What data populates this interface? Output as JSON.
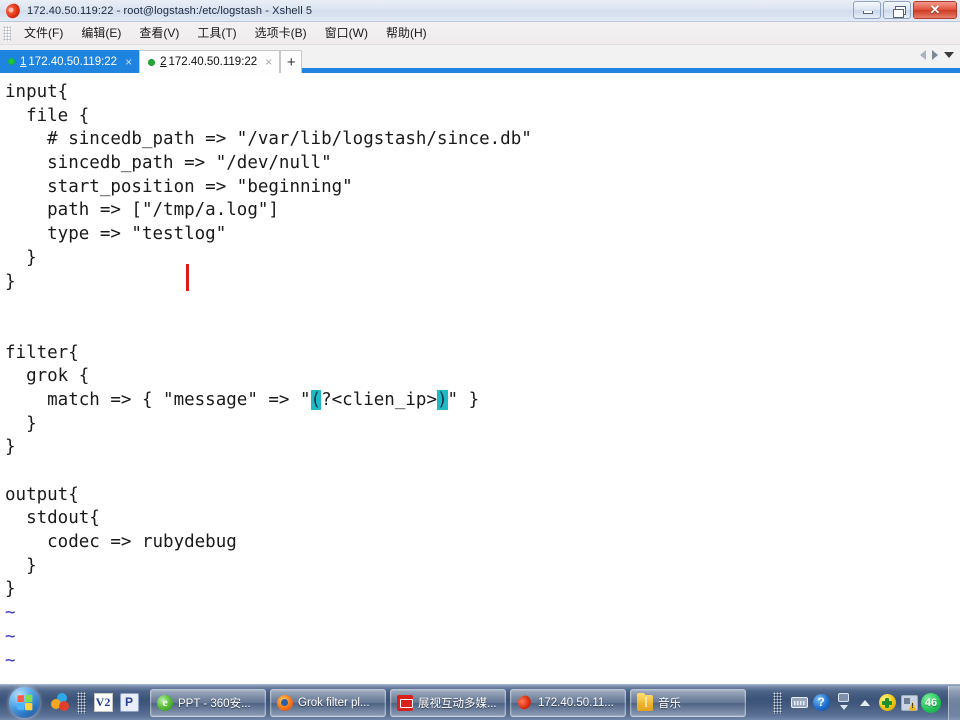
{
  "window": {
    "title": "172.40.50.119:22 - root@logstash:/etc/logstash - Xshell 5",
    "app_icon": "xshell-icon",
    "buttons": {
      "minimize": "minimize-icon",
      "maximize": "maximize-icon",
      "close": "✕"
    }
  },
  "menubar": {
    "items": [
      {
        "label": "文件(F)"
      },
      {
        "label": "编辑(E)"
      },
      {
        "label": "查看(V)"
      },
      {
        "label": "工具(T)"
      },
      {
        "label": "选项卡(B)"
      },
      {
        "label": "窗口(W)"
      },
      {
        "label": "帮助(H)"
      }
    ]
  },
  "tabs": {
    "items": [
      {
        "number": "1",
        "label": "172.40.50.119:22",
        "active": true,
        "status": "connected",
        "close": "×"
      },
      {
        "number": "2",
        "label": "172.40.50.119:22",
        "active": false,
        "status": "connected",
        "close": "×"
      }
    ],
    "add_label": "+",
    "nav": {
      "prev": "tab-scroll-left-icon",
      "next": "tab-scroll-right-icon",
      "list": "tab-list-dropdown-icon"
    }
  },
  "terminal": {
    "accent_highlight": "#1eb9c6",
    "cursor_color": "#e01919",
    "tilde_color": "#3a37c9",
    "lines": [
      {
        "segments": [
          {
            "text": "input{"
          }
        ]
      },
      {
        "segments": [
          {
            "text": "  file {"
          }
        ]
      },
      {
        "segments": [
          {
            "text": "    # sincedb_path => \"/var/lib/logstash/since.db\""
          }
        ]
      },
      {
        "segments": [
          {
            "text": "    sincedb_path => \"/dev/null\""
          }
        ]
      },
      {
        "segments": [
          {
            "text": "    start_position => \"beginning\""
          }
        ]
      },
      {
        "segments": [
          {
            "text": "    path => [\"/tmp/a.log\"]"
          }
        ]
      },
      {
        "segments": [
          {
            "text": "    type => \"testlog\""
          }
        ]
      },
      {
        "segments": [
          {
            "text": "  }"
          }
        ]
      },
      {
        "segments": [
          {
            "text": "}"
          }
        ]
      },
      {
        "segments": [
          {
            "text": ""
          }
        ]
      },
      {
        "segments": [
          {
            "text": ""
          }
        ]
      },
      {
        "segments": [
          {
            "text": "filter{"
          }
        ]
      },
      {
        "segments": [
          {
            "text": "  grok {"
          }
        ]
      },
      {
        "segments": [
          {
            "text": "    match => { \"message\" => \""
          },
          {
            "text": "(",
            "highlight": true
          },
          {
            "text": "?<clien_ip>"
          },
          {
            "text": ")",
            "highlight": true
          },
          {
            "text": "\" }"
          }
        ]
      },
      {
        "segments": [
          {
            "text": "  }"
          }
        ]
      },
      {
        "segments": [
          {
            "text": "}"
          }
        ]
      },
      {
        "segments": [
          {
            "text": ""
          }
        ]
      },
      {
        "segments": [
          {
            "text": "output{"
          }
        ]
      },
      {
        "segments": [
          {
            "text": "  stdout{"
          }
        ]
      },
      {
        "segments": [
          {
            "text": "    codec => rubydebug"
          }
        ]
      },
      {
        "segments": [
          {
            "text": "  }"
          }
        ]
      },
      {
        "segments": [
          {
            "text": "}"
          }
        ]
      },
      {
        "segments": [
          {
            "text": "~",
            "tilde": true
          }
        ]
      },
      {
        "segments": [
          {
            "text": "~",
            "tilde": true
          }
        ]
      },
      {
        "segments": [
          {
            "text": "~",
            "tilde": true
          }
        ]
      }
    ]
  },
  "taskbar": {
    "start_label": "start-orb",
    "quick_launch": [
      {
        "name": "360-safe-icon",
        "kind": "360"
      },
      {
        "name": "quicklaunch-grip",
        "kind": "grip"
      },
      {
        "name": "vmware-icon",
        "kind": "v2",
        "label": "V2"
      },
      {
        "name": "powerpoint-icon",
        "kind": "p",
        "label": "P"
      }
    ],
    "tasks": [
      {
        "icon": "ie-icon",
        "kind": "ie",
        "label": "PPT - 360安..."
      },
      {
        "icon": "firefox-icon",
        "kind": "ff",
        "label": "Grok filter pl..."
      },
      {
        "icon": "zhanshi-icon",
        "kind": "zs",
        "label": "展视互动多媒..."
      },
      {
        "icon": "xshell-icon",
        "kind": "xs",
        "label": "172.40.50.11..."
      },
      {
        "icon": "folder-icon",
        "kind": "fold",
        "label": "音乐"
      }
    ],
    "tray": [
      {
        "name": "keyboard-icon",
        "kind": "kbd"
      },
      {
        "name": "help-icon",
        "kind": "help",
        "label": "?"
      },
      {
        "name": "ime-icon",
        "kind": "ime"
      },
      {
        "name": "show-hidden-icons-icon",
        "kind": "up"
      },
      {
        "name": "update-plus-icon",
        "kind": "plus"
      },
      {
        "name": "action-center-icon",
        "kind": "shield"
      },
      {
        "name": "notification-count-badge",
        "kind": "badge",
        "label": "46"
      }
    ],
    "show_desktop": "show-desktop-button"
  }
}
